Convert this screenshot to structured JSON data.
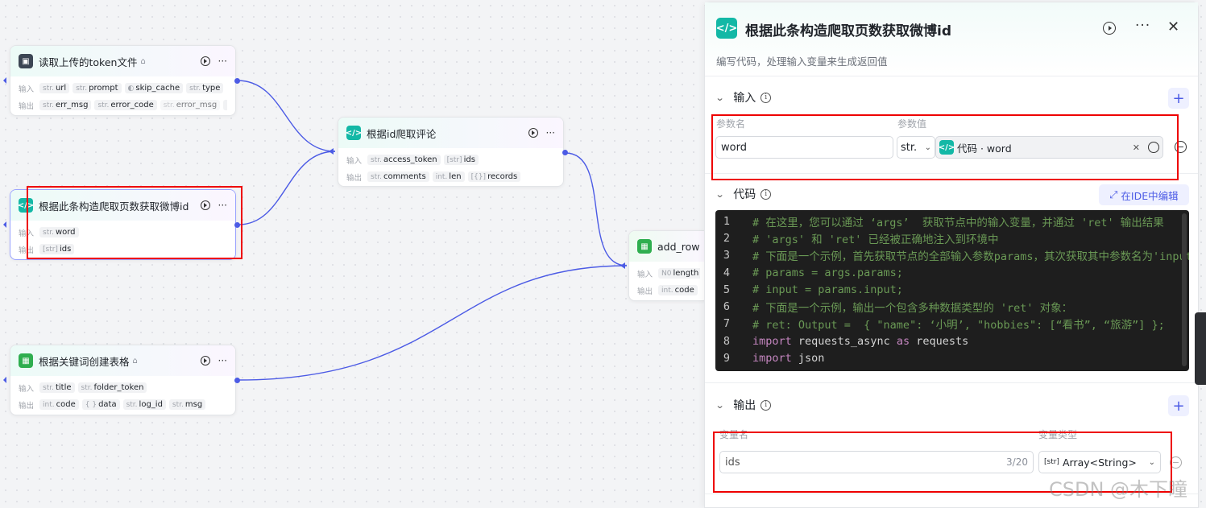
{
  "nodes": {
    "token_file": {
      "title": "读取上传的token文件",
      "input_label": "输入",
      "output_label": "输出",
      "inputs": [
        {
          "type": "str.",
          "name": "url"
        },
        {
          "type": "str.",
          "name": "prompt"
        },
        {
          "type": "",
          "name": "skip_cache"
        },
        {
          "type": "str.",
          "name": "type"
        }
      ],
      "outputs": [
        {
          "type": "str.",
          "name": "err_msg"
        },
        {
          "type": "str.",
          "name": "error_code"
        },
        {
          "type": "str.",
          "name": "error_msg"
        }
      ],
      "more": "···"
    },
    "crawl_comments": {
      "title": "根据id爬取评论",
      "input_label": "输入",
      "output_label": "输出",
      "inputs": [
        {
          "type": "str.",
          "name": "access_token"
        },
        {
          "type": "[str]",
          "name": "ids"
        }
      ],
      "outputs": [
        {
          "type": "str.",
          "name": "comments"
        },
        {
          "type": "int.",
          "name": "len"
        },
        {
          "type": "[{}]",
          "name": "records"
        }
      ]
    },
    "get_weibo_id": {
      "title": "根据此条构造爬取页数获取微博id",
      "input_label": "输入",
      "output_label": "输出",
      "inputs": [
        {
          "type": "str.",
          "name": "word"
        }
      ],
      "outputs": [
        {
          "type": "[str]",
          "name": "ids"
        }
      ]
    },
    "add_rows": {
      "title": "add_rows",
      "input_label": "输入",
      "output_label": "输出",
      "inputs": [
        {
          "type": "N0",
          "name": "length"
        }
      ],
      "outputs": [
        {
          "type": "int.",
          "name": "code"
        },
        {
          "type": "{ }",
          "name": ""
        }
      ]
    },
    "create_table": {
      "title": "根据关键词创建表格",
      "input_label": "输入",
      "output_label": "输出",
      "inputs": [
        {
          "type": "str.",
          "name": "title"
        },
        {
          "type": "str.",
          "name": "folder_token"
        }
      ],
      "outputs": [
        {
          "type": "int.",
          "name": "code"
        },
        {
          "type": "{ }",
          "name": "data"
        },
        {
          "type": "str.",
          "name": "log_id"
        },
        {
          "type": "str.",
          "name": "msg"
        }
      ]
    }
  },
  "panel": {
    "title": "根据此条构造爬取页数获取微博id",
    "description": "编写代码，处理输入变量来生成返回值",
    "input_section": {
      "title": "输入",
      "col_name": "参数名",
      "col_value": "参数值",
      "param_name": "word",
      "param_type": "str.",
      "param_value": "代码 · word"
    },
    "code_section": {
      "title": "代码",
      "ide_button": "在IDE中编辑",
      "lines": [
        {
          "n": "1",
          "cls": "cm",
          "text": "# 在这里，您可以通过 ‘args’  获取节点中的输入变量，并通过 'ret' 输出结果"
        },
        {
          "n": "2",
          "cls": "cm",
          "text": "# 'args' 和 'ret' 已经被正确地注入到环境中"
        },
        {
          "n": "3",
          "cls": "cm",
          "text": "# 下面是一个示例，首先获取节点的全部输入参数params，其次获取其中参数名为'input'的值："
        },
        {
          "n": "4",
          "cls": "cm",
          "text": "# params = args.params;"
        },
        {
          "n": "5",
          "cls": "cm",
          "text": "# input = params.input;"
        },
        {
          "n": "6",
          "cls": "cm",
          "text": "# 下面是一个示例，输出一个包含多种数据类型的 'ret' 对象："
        },
        {
          "n": "7",
          "cls": "cm",
          "text": "# ret: Output =  { \"name\": ‘小明’, \"hobbies\": [“看书”, “旅游”] };"
        },
        {
          "n": "8",
          "cls": "code",
          "kw": "import",
          "rest": " requests_async ",
          "kw2": "as",
          "rest2": " requests"
        },
        {
          "n": "9",
          "cls": "code",
          "kw": "import",
          "rest": " json",
          "kw2": "",
          "rest2": ""
        }
      ]
    },
    "output_section": {
      "title": "输出",
      "col_name": "变量名",
      "col_type": "变量类型",
      "var_name": "ids",
      "var_count": "3/20",
      "var_type_icon": "[str]",
      "var_type": "Array<String>"
    }
  },
  "watermark": "CSDN @木下瞳",
  "colors": {
    "edge": "#4c5be5",
    "highlight": "#e00000",
    "code_bg": "#1e1e1e",
    "accent": "#4c5be5"
  }
}
